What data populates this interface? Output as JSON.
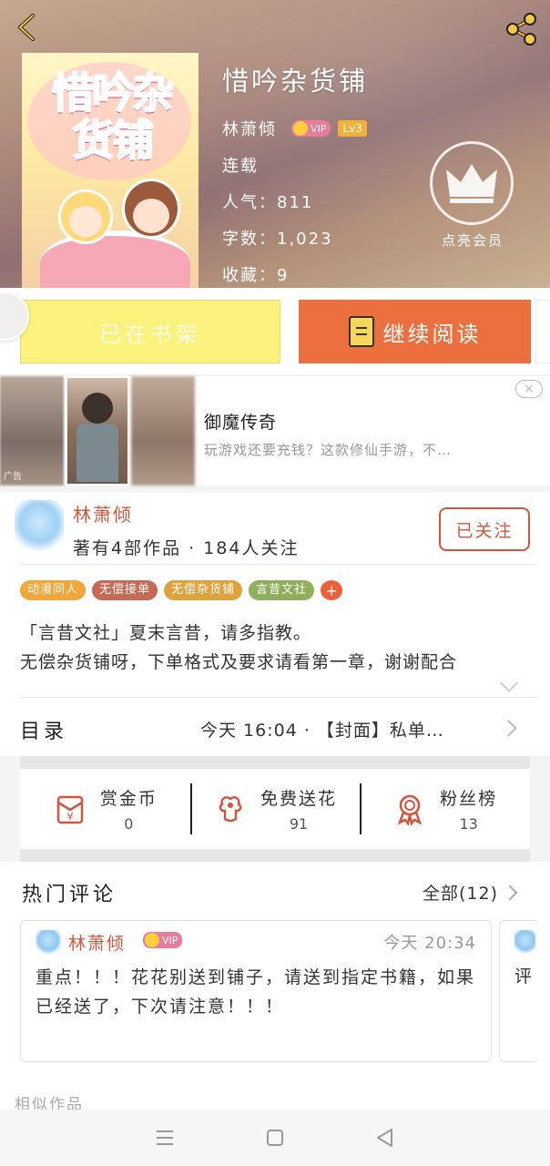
{
  "header": {
    "book_title": "惜吟杂货铺",
    "author": "林萧倾",
    "vip_label": "VIP",
    "level": "Lv3",
    "status": "连载",
    "popularity": "人气：811",
    "word_count": "字数：1,023",
    "favorites": "收藏：9",
    "member_label": "点亮会员",
    "cover_text": "惜吟杂货铺"
  },
  "actions": {
    "shelf_label": "已在书架",
    "read_label": "继续阅读"
  },
  "ad": {
    "title": "御魔传奇",
    "description": "玩游戏还要充钱？这款修仙手游，不…",
    "tag": "广告",
    "close_icon": "×"
  },
  "author_section": {
    "name": "林萧倾",
    "stats": "著有4部作品 · 184人关注",
    "follow_label": "已关注",
    "tags": [
      {
        "label": "动漫同人",
        "color": "#f3a63a"
      },
      {
        "label": "无偿接单",
        "color": "#c56b55"
      },
      {
        "label": "无偿杂货铺",
        "color": "#dfa23c"
      },
      {
        "label": "言昔文社",
        "color": "#8fb05a"
      }
    ],
    "tag_more": "+",
    "intro_line1": "「言昔文社」夏末言昔，请多指教。",
    "intro_line2": "无偿杂货铺呀，下单格式及要求请看第一章，谢谢配合",
    "toc_label": "目录",
    "toc_latest": "今天 16:04 · 【封面】私单…"
  },
  "stats": [
    {
      "label": "赏金币",
      "value": "0",
      "icon": "reward-coin-icon"
    },
    {
      "label": "免费送花",
      "value": "91",
      "icon": "flower-icon"
    },
    {
      "label": "粉丝榜",
      "value": "13",
      "icon": "medal-icon"
    }
  ],
  "comments": {
    "title": "热门评论",
    "all_label": "全部(12)",
    "items": [
      {
        "author": "林萧倾",
        "vip": "VIP",
        "time": "今天 20:34",
        "text": "重点！！！花花别送到铺子，请送到指定书籍，如果已经送了，下次请注意！！！"
      },
      {
        "text": "评"
      }
    ],
    "similar_label": "相似作品"
  },
  "colors": {
    "accent": "#ec6f3f",
    "author_red": "#d2553e",
    "shelf_yellow": "#faf27c"
  }
}
